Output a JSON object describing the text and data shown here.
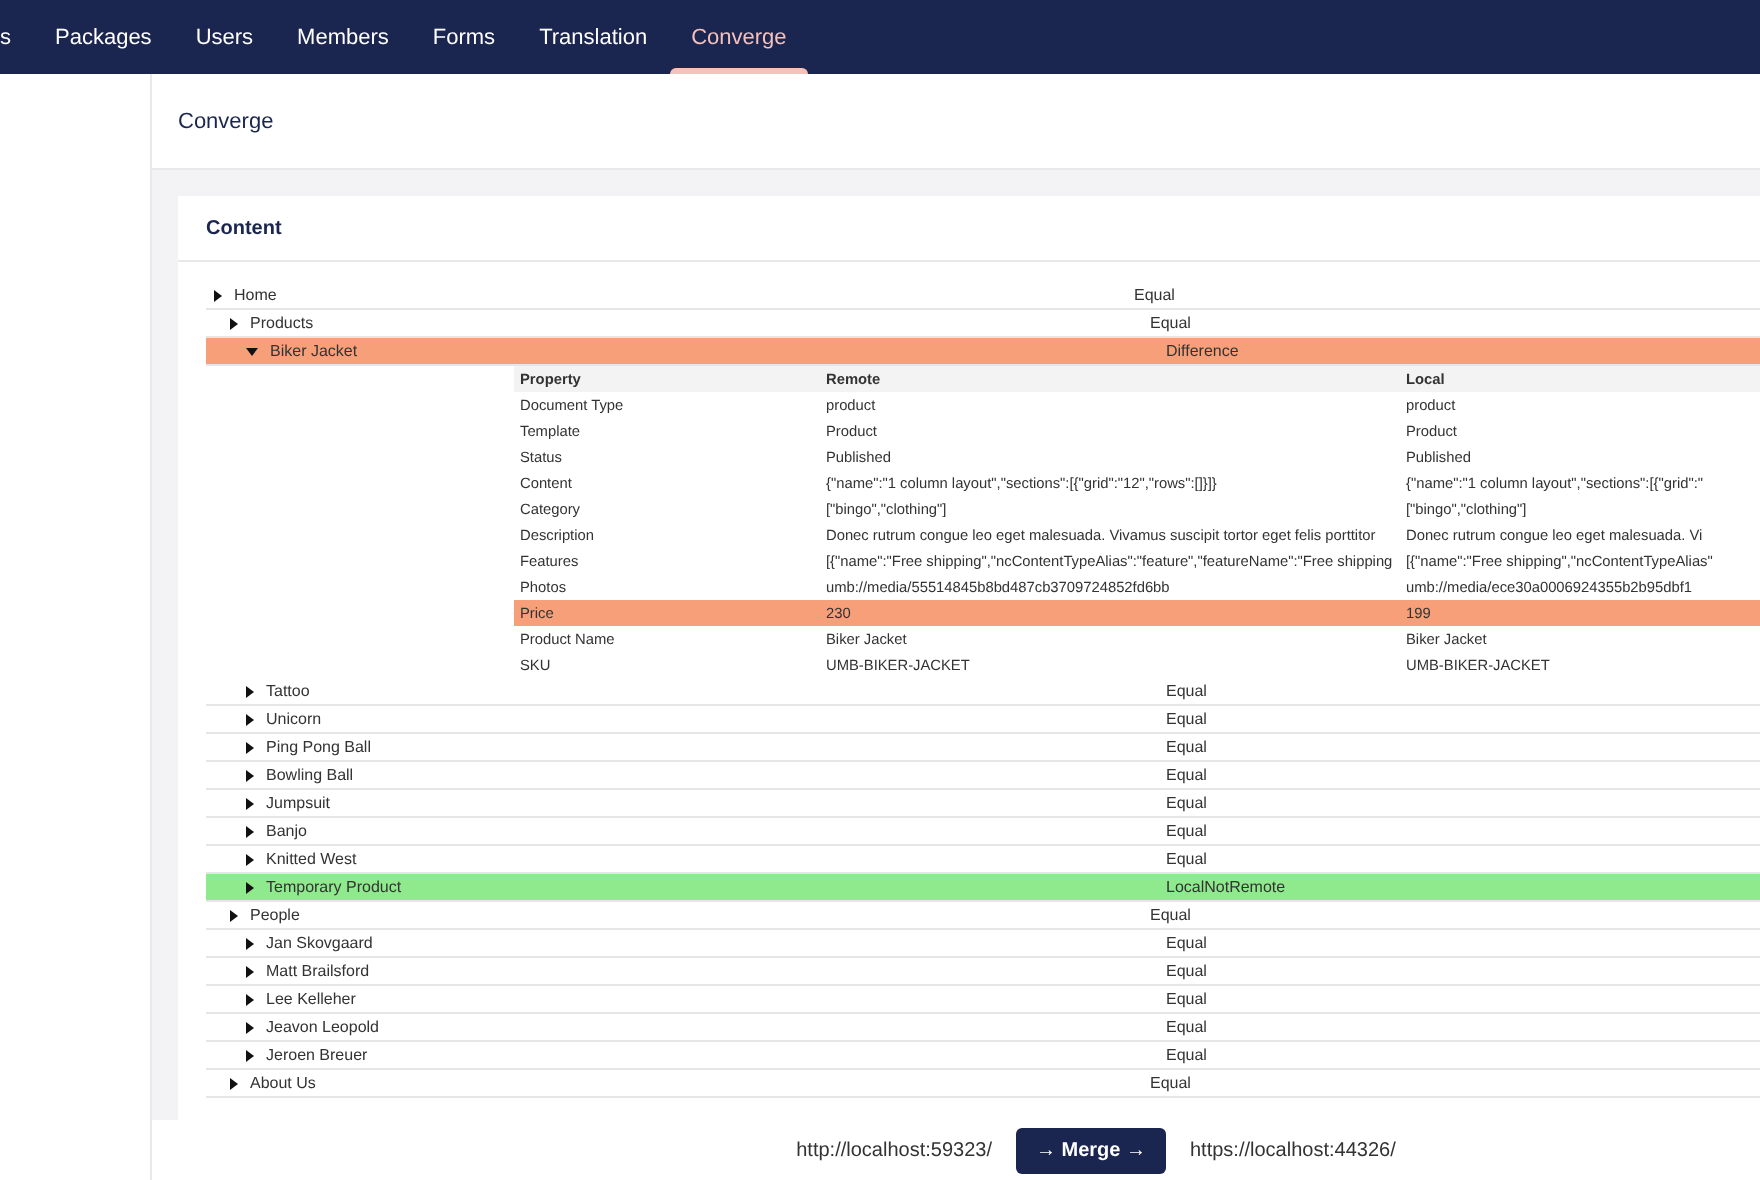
{
  "top_nav": {
    "tabs": [
      {
        "label": "s",
        "selected": false
      },
      {
        "label": "Packages",
        "selected": false
      },
      {
        "label": "Users",
        "selected": false
      },
      {
        "label": "Members",
        "selected": false
      },
      {
        "label": "Forms",
        "selected": false
      },
      {
        "label": "Translation",
        "selected": false
      },
      {
        "label": "Converge",
        "selected": true
      }
    ]
  },
  "page_title": "Converge",
  "content_panel": {
    "title": "Content",
    "tree": [
      {
        "name": "Home",
        "status": "Equal",
        "kind": "equal",
        "expanded": false,
        "children": [
          {
            "name": "Products",
            "status": "Equal",
            "kind": "equal",
            "expanded": false,
            "children": [
              {
                "name": "Biker Jacket",
                "status": "Difference",
                "kind": "difference",
                "expanded": true,
                "details": {
                  "columns": [
                    "Property",
                    "Remote",
                    "Local"
                  ],
                  "rows": [
                    {
                      "cells": [
                        "Document Type",
                        "product",
                        "product"
                      ],
                      "differs": false
                    },
                    {
                      "cells": [
                        "Template",
                        "Product",
                        "Product"
                      ],
                      "differs": false
                    },
                    {
                      "cells": [
                        "Status",
                        "Published",
                        "Published"
                      ],
                      "differs": false
                    },
                    {
                      "cells": [
                        "Content",
                        "{\"name\":\"1 column layout\",\"sections\":[{\"grid\":\"12\",\"rows\":[]}]}",
                        "{\"name\":\"1 column layout\",\"sections\":[{\"grid\":\""
                      ],
                      "differs": false
                    },
                    {
                      "cells": [
                        "Category",
                        "[\"bingo\",\"clothing\"]",
                        "[\"bingo\",\"clothing\"]"
                      ],
                      "differs": false
                    },
                    {
                      "cells": [
                        "Description",
                        "Donec rutrum congue leo eget malesuada. Vivamus suscipit tortor eget felis porttitor",
                        "Donec rutrum congue leo eget malesuada. Vi"
                      ],
                      "differs": false
                    },
                    {
                      "cells": [
                        "Features",
                        "[{\"name\":\"Free shipping\",\"ncContentTypeAlias\":\"feature\",\"featureName\":\"Free shipping",
                        "[{\"name\":\"Free shipping\",\"ncContentTypeAlias\""
                      ],
                      "differs": false
                    },
                    {
                      "cells": [
                        "Photos",
                        "umb://media/55514845b8bd487cb3709724852fd6bb",
                        "umb://media/ece30a0006924355b2b95dbf1"
                      ],
                      "differs": false
                    },
                    {
                      "cells": [
                        "Price",
                        "230",
                        "199"
                      ],
                      "differs": true
                    },
                    {
                      "cells": [
                        "Product Name",
                        "Biker Jacket",
                        "Biker Jacket"
                      ],
                      "differs": false
                    },
                    {
                      "cells": [
                        "SKU",
                        "UMB-BIKER-JACKET",
                        "UMB-BIKER-JACKET"
                      ],
                      "differs": false
                    }
                  ]
                }
              },
              {
                "name": "Tattoo",
                "status": "Equal",
                "kind": "equal",
                "expanded": false
              },
              {
                "name": "Unicorn",
                "status": "Equal",
                "kind": "equal",
                "expanded": false
              },
              {
                "name": "Ping Pong Ball",
                "status": "Equal",
                "kind": "equal",
                "expanded": false
              },
              {
                "name": "Bowling Ball",
                "status": "Equal",
                "kind": "equal",
                "expanded": false
              },
              {
                "name": "Jumpsuit",
                "status": "Equal",
                "kind": "equal",
                "expanded": false
              },
              {
                "name": "Banjo",
                "status": "Equal",
                "kind": "equal",
                "expanded": false
              },
              {
                "name": "Knitted West",
                "status": "Equal",
                "kind": "equal",
                "expanded": false
              },
              {
                "name": "Temporary Product",
                "status": "LocalNotRemote",
                "kind": "added",
                "expanded": false
              }
            ]
          },
          {
            "name": "People",
            "status": "Equal",
            "kind": "equal",
            "expanded": false,
            "children": [
              {
                "name": "Jan Skovgaard",
                "status": "Equal",
                "kind": "equal",
                "expanded": false
              },
              {
                "name": "Matt Brailsford",
                "status": "Equal",
                "kind": "equal",
                "expanded": false
              },
              {
                "name": "Lee Kelleher",
                "status": "Equal",
                "kind": "equal",
                "expanded": false
              },
              {
                "name": "Jeavon Leopold",
                "status": "Equal",
                "kind": "equal",
                "expanded": false
              },
              {
                "name": "Jeroen Breuer",
                "status": "Equal",
                "kind": "equal",
                "expanded": false
              }
            ]
          },
          {
            "name": "About Us",
            "status": "Equal",
            "kind": "equal",
            "expanded": false
          }
        ]
      }
    ]
  },
  "footer": {
    "remote_url": "http://localhost:59323/",
    "merge_button": "→ Merge →",
    "local_url": "https://localhost:44326/"
  }
}
